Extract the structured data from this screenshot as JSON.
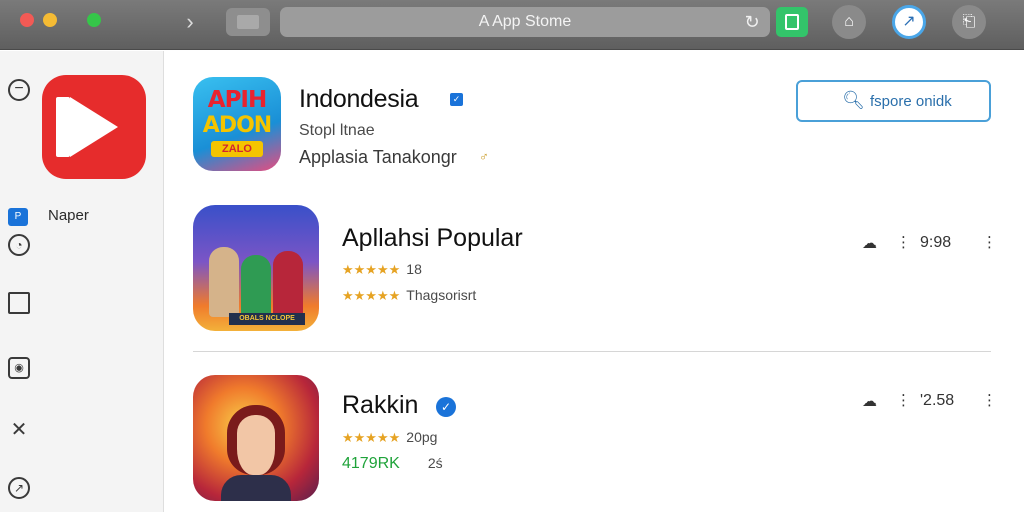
{
  "window": {
    "address": "A  App Stome"
  },
  "toolbar": {
    "forward_icon": "chevron-right-icon",
    "reload_icon": "reload-icon",
    "bell_glyph": "⌂",
    "msg_glyph": "↗",
    "share_glyph": "⎗"
  },
  "sidebar": {
    "minus_glyph": "−",
    "row_label": "Naper",
    "row_badge": "P",
    "clock_glyph": "◔",
    "camera_glyph": "◉",
    "tools_glyph": "✕",
    "compass_glyph": "↗"
  },
  "hero": {
    "icon_line1": "APIH",
    "icon_line2": "ADON",
    "icon_line3": "ZALO",
    "title": "Indondesia",
    "verified_glyph": "✓",
    "subtitle": "Stopl ltnae",
    "category": "Applasia Tanakongr",
    "category_glyph": "♂"
  },
  "search": {
    "icon_glyph": "🔍︎",
    "label": "fspore onidk"
  },
  "apps": [
    {
      "title": "Apllahsi Popular",
      "icon_tag": "OBALS NCLOPE",
      "stars": "★★★★★",
      "rating": "18",
      "stars2": "★★★★★",
      "sub": "Thagsorisrt",
      "meta_glyph": "☁",
      "meta_value": "9:98",
      "meta_dots": "⋮"
    },
    {
      "title": "Rakkin",
      "verified_glyph": "✓",
      "stars": "★★★★★",
      "rating": "20pg",
      "price": "4179RK",
      "price_sub": "2ś",
      "meta_glyph": "☁",
      "meta_value": "'2.58",
      "meta_dots": "⋮"
    }
  ],
  "colors": {
    "accent": "#1a73d9",
    "search_border": "#4aa0d8",
    "star": "#e6a323",
    "price_green": "#1fa33a",
    "logo_red": "#e62c2c"
  }
}
